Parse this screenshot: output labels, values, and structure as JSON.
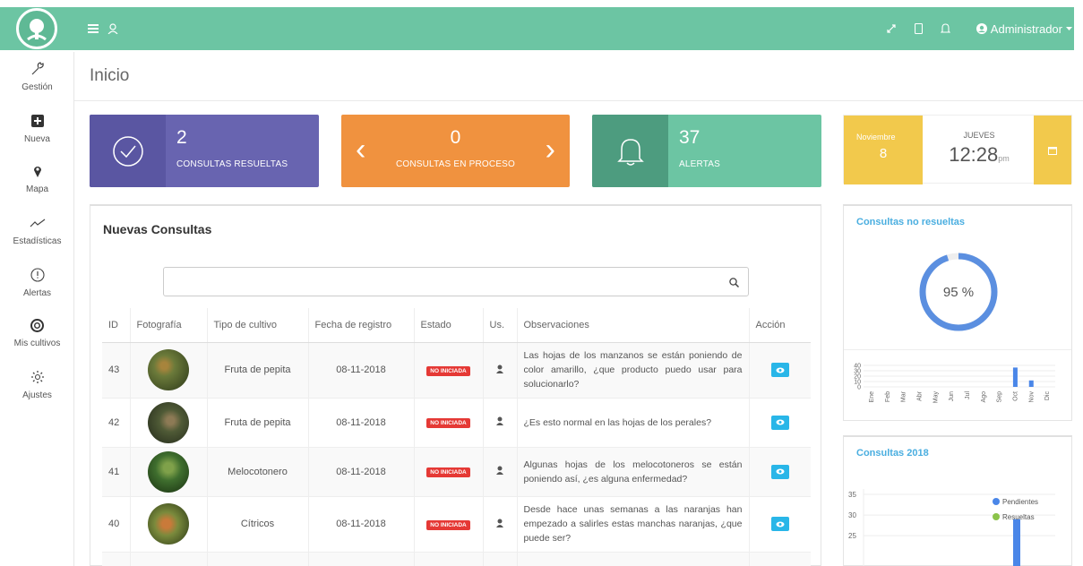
{
  "topbar": {
    "menu_icon": "hamburger-icon",
    "user_icon": "user-outline-icon",
    "expand_icon": "expand-icon",
    "tablet_icon": "tablet-icon",
    "bell_icon": "bell-icon",
    "admin_label": "Administrador"
  },
  "sidebar": {
    "items": [
      {
        "label": "Gestión",
        "icon": "wrench-icon"
      },
      {
        "label": "Nueva",
        "icon": "plus-square-icon"
      },
      {
        "label": "Mapa",
        "icon": "map-pin-icon"
      },
      {
        "label": "Estadísticas",
        "icon": "trend-line-icon"
      },
      {
        "label": "Alertas",
        "icon": "alert-circle-icon"
      },
      {
        "label": "Mis cultivos",
        "icon": "lifebuoy-icon"
      },
      {
        "label": "Ajustes",
        "icon": "gear-icon"
      }
    ]
  },
  "page": {
    "title": "Inicio"
  },
  "stats": {
    "resueltas": {
      "value": "2",
      "label": "CONSULTAS RESUELTAS"
    },
    "proceso": {
      "value": "0",
      "label": "CONSULTAS EN PROCESO"
    },
    "alertas": {
      "value": "37",
      "label": "ALERTAS"
    }
  },
  "date": {
    "month": "Noviembre",
    "day": "8",
    "weekday": "JUEVES",
    "time": "12:28",
    "ampm": "pm"
  },
  "consultas": {
    "title": "Nuevas Consultas",
    "search_placeholder": "",
    "headers": [
      "ID",
      "Fotografía",
      "Tipo de cultivo",
      "Fecha de registro",
      "Estado",
      "Us.",
      "Observaciones",
      "Acción"
    ],
    "rows": [
      {
        "id": "43",
        "tipo": "Fruta de pepita",
        "fecha": "08-11-2018",
        "estado": "NO INICIADA",
        "obs": "Las hojas de los manzanos se están poniendo de color amarillo, ¿que producto puedo usar para solucionarlo?",
        "photo_color": "#6b7a3a"
      },
      {
        "id": "42",
        "tipo": "Fruta de pepita",
        "fecha": "08-11-2018",
        "estado": "NO INICIADA",
        "obs": "¿Es esto normal en las hojas de los perales?",
        "photo_color": "#4f5a36"
      },
      {
        "id": "41",
        "tipo": "Melocotonero",
        "fecha": "08-11-2018",
        "estado": "NO INICIADA",
        "obs": "Algunas hojas de los melocotoneros se están poniendo así, ¿es alguna enfermedad?",
        "photo_color": "#3f6e2e"
      },
      {
        "id": "40",
        "tipo": "Cítricos",
        "fecha": "08-11-2018",
        "estado": "NO INICIADA",
        "obs": "Desde hace unas semanas a las naranjas han empezado a salirles estas manchas naranjas, ¿que puede ser?",
        "photo_color": "#7a8a3c"
      }
    ]
  },
  "no_resueltas": {
    "title": "Consultas no resueltas",
    "percent": 95,
    "percent_label": "95 %"
  },
  "chart_data": [
    {
      "type": "bar",
      "categories": [
        "Ene",
        "Feb",
        "Mar",
        "Abr",
        "May",
        "Jun",
        "Jul",
        "Ago",
        "Sep",
        "Oct",
        "Nov",
        "Dic"
      ],
      "values": [
        0,
        0,
        0,
        0,
        0,
        0,
        0,
        0,
        0,
        36,
        12,
        0
      ],
      "yticks": [
        "40",
        "30",
        "20",
        "10",
        "0"
      ],
      "ylim": [
        0,
        40
      ],
      "color": "#4a86e8"
    },
    {
      "type": "bar",
      "title": "Consultas 2018",
      "yticks": [
        "35",
        "30",
        "25"
      ],
      "ylim": [
        22,
        35
      ],
      "series": [
        {
          "name": "Pendientes",
          "color": "#4a86e8"
        },
        {
          "name": "Resueltas",
          "color": "#8bc34a"
        }
      ],
      "visible_bar_value": 29,
      "legend": "top-right"
    }
  ],
  "colors": {
    "brand": "#6cc5a3",
    "purple": "#6864b0",
    "orange": "#f0923f",
    "yellow": "#f2c94c",
    "badge_red": "#e53935",
    "action_blue": "#29b6e8"
  }
}
